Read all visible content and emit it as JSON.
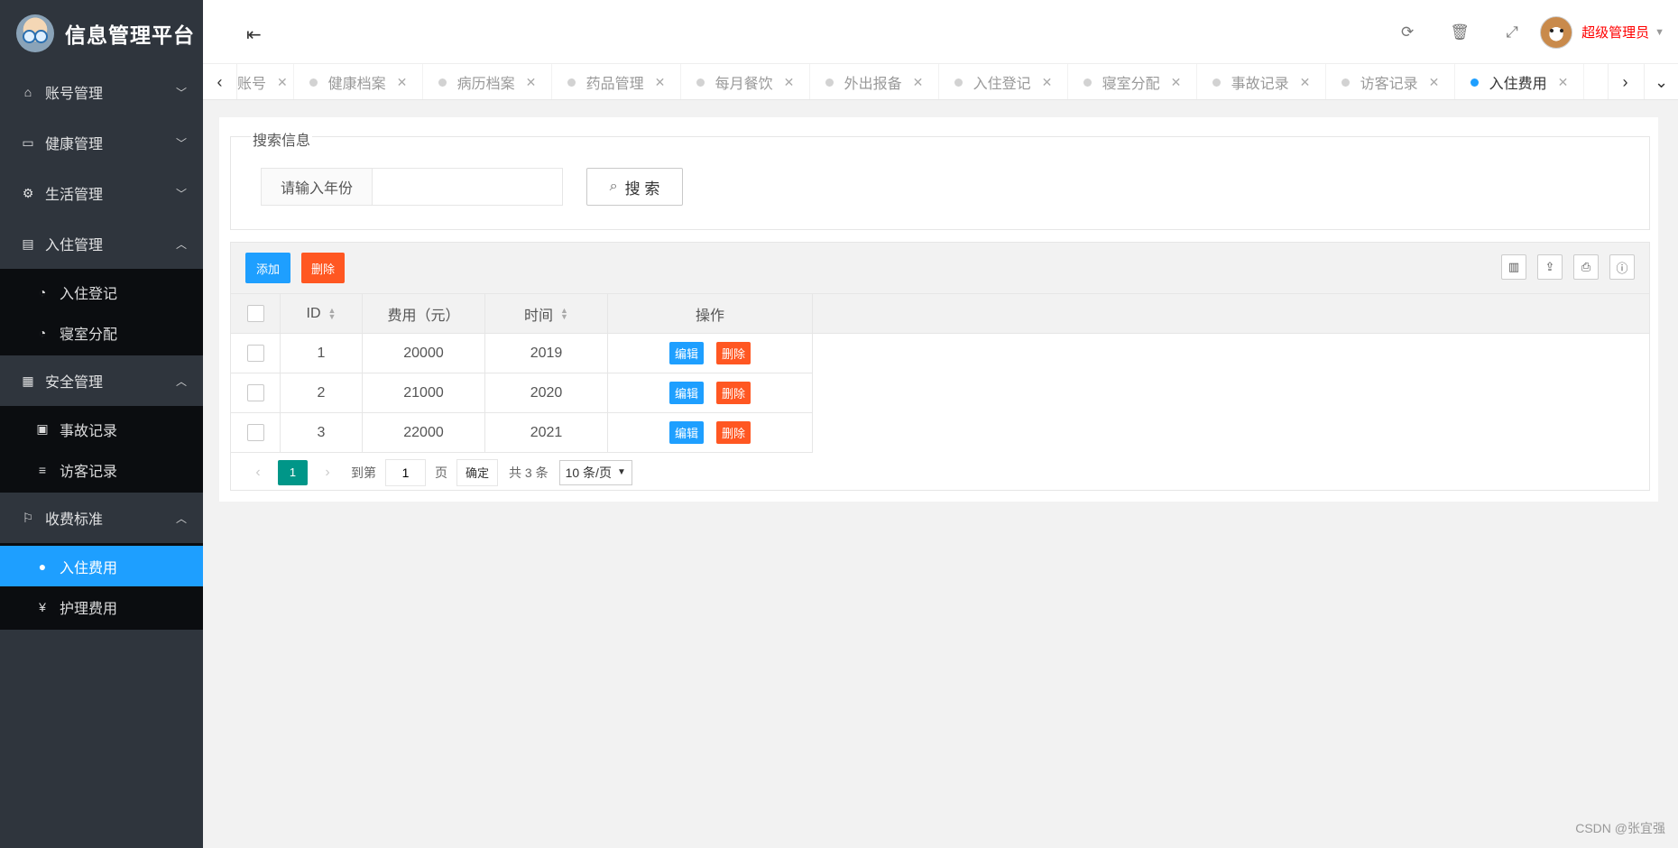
{
  "app": {
    "title": "信息管理平台"
  },
  "sidebar": {
    "groups": [
      {
        "label": "账号管理",
        "icon": "home-icon",
        "expanded": false
      },
      {
        "label": "健康管理",
        "icon": "window-icon",
        "expanded": false
      },
      {
        "label": "生活管理",
        "icon": "gears-icon",
        "expanded": false
      },
      {
        "label": "入住管理",
        "icon": "file-icon",
        "expanded": true,
        "items": [
          {
            "label": "入住登记",
            "icon": "dashboard-icon"
          },
          {
            "label": "寝室分配",
            "icon": "dashboard-icon"
          }
        ]
      },
      {
        "label": "安全管理",
        "icon": "calendar-icon",
        "expanded": true,
        "items": [
          {
            "label": "事故记录",
            "icon": "list-box-icon"
          },
          {
            "label": "访客记录",
            "icon": "menu-lines-icon"
          }
        ]
      },
      {
        "label": "收费标准",
        "icon": "flag-icon",
        "expanded": true,
        "items": [
          {
            "label": "入住费用",
            "icon": "coin-icon",
            "active": true
          },
          {
            "label": "护理费用",
            "icon": "yen-icon"
          }
        ]
      }
    ]
  },
  "header": {
    "user_name": "超级管理员",
    "icons": [
      "refresh-icon",
      "trash-icon",
      "fullscreen-icon"
    ]
  },
  "tabs": [
    {
      "label": "账号"
    },
    {
      "label": "健康档案"
    },
    {
      "label": "病历档案"
    },
    {
      "label": "药品管理"
    },
    {
      "label": "每月餐饮"
    },
    {
      "label": "外出报备"
    },
    {
      "label": "入住登记"
    },
    {
      "label": "寝室分配"
    },
    {
      "label": "事故记录"
    },
    {
      "label": "访客记录"
    },
    {
      "label": "入住费用",
      "active": true
    }
  ],
  "search": {
    "legend": "搜索信息",
    "label": "请输入年份",
    "value": "",
    "button": "搜 索"
  },
  "toolbar": {
    "add": "添加",
    "delete": "删除"
  },
  "table": {
    "columns": [
      "ID",
      "费用（元）",
      "时间",
      "操作"
    ],
    "rows": [
      {
        "id": "1",
        "fee": "20000",
        "year": "2019"
      },
      {
        "id": "2",
        "fee": "21000",
        "year": "2020"
      },
      {
        "id": "3",
        "fee": "22000",
        "year": "2021"
      }
    ],
    "edit_label": "编辑",
    "delete_label": "删除"
  },
  "pager": {
    "current": "1",
    "goto_prefix": "到第",
    "goto_value": "1",
    "goto_suffix": "页",
    "confirm": "确定",
    "total": "共 3 条",
    "page_size": "10 条/页"
  },
  "watermark": "CSDN @张宜强",
  "colors": {
    "primary": "#1e9fff",
    "danger": "#ff5722",
    "pager": "#009688",
    "sidebar": "#2f353d",
    "user": "#ff0000"
  }
}
